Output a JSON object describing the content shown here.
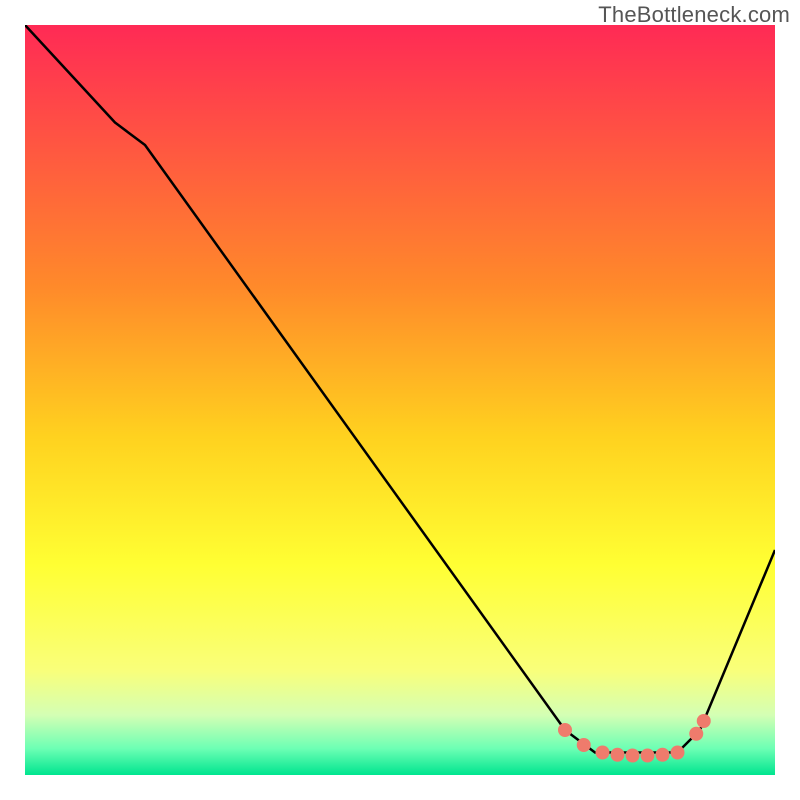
{
  "watermark": "TheBottleneck.com",
  "chart_data": {
    "type": "line",
    "title": "",
    "xlabel": "",
    "ylabel": "",
    "xlim": [
      0,
      100
    ],
    "ylim": [
      0,
      100
    ],
    "background_gradient": {
      "stops": [
        {
          "offset": 0.0,
          "color": "#ff2a55"
        },
        {
          "offset": 0.35,
          "color": "#ff8a2a"
        },
        {
          "offset": 0.55,
          "color": "#ffd21f"
        },
        {
          "offset": 0.72,
          "color": "#ffff33"
        },
        {
          "offset": 0.86,
          "color": "#f9ff7a"
        },
        {
          "offset": 0.92,
          "color": "#d4ffb4"
        },
        {
          "offset": 0.965,
          "color": "#6cffb4"
        },
        {
          "offset": 1.0,
          "color": "#00e58f"
        }
      ]
    },
    "curve": {
      "x": [
        0,
        12,
        16,
        72,
        76,
        87,
        90,
        100
      ],
      "y": [
        100,
        87,
        84,
        6,
        3,
        3,
        6,
        30
      ],
      "stroke": "#000000",
      "width": 2.5
    },
    "markers": {
      "x": [
        72,
        74.5,
        77,
        79,
        81,
        83,
        85,
        87,
        89.5,
        90.5
      ],
      "y": [
        6,
        4,
        3,
        2.7,
        2.6,
        2.6,
        2.7,
        3,
        5.5,
        7.2
      ],
      "color": "#ef7b6c",
      "radius": 7
    }
  }
}
